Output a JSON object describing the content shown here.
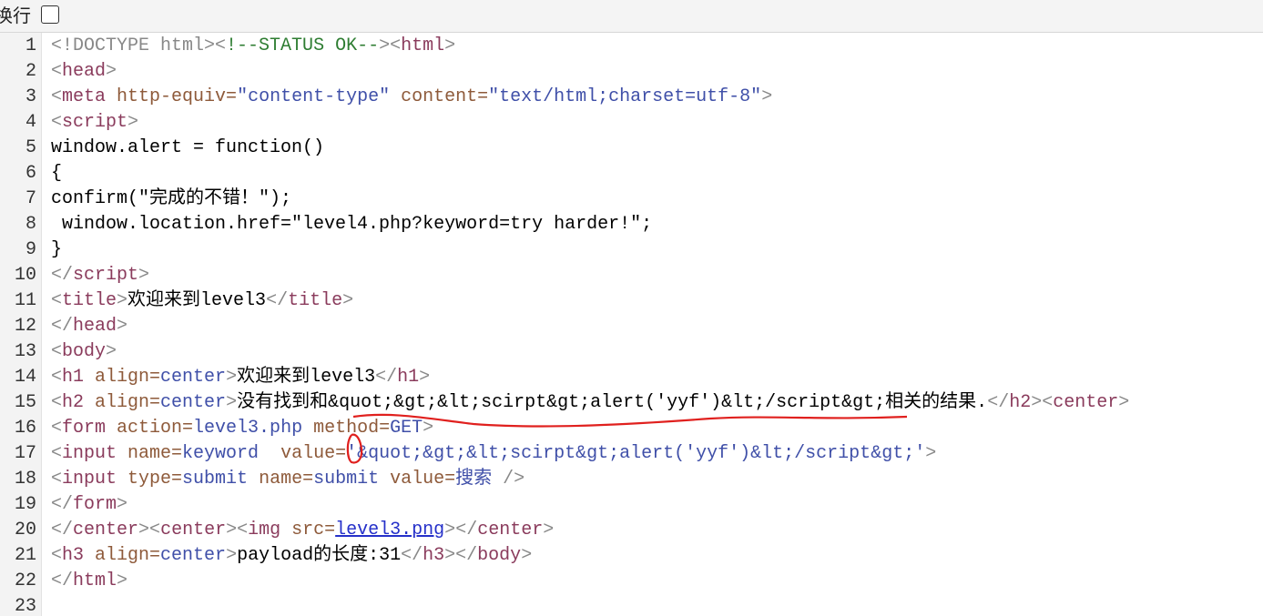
{
  "toolbar": {
    "wrap_label": "换行"
  },
  "lines": [
    {
      "num": "1",
      "parts": [
        {
          "cls": "g",
          "t": "<!DOCTYPE html>"
        },
        {
          "cls": "g",
          "t": "<"
        },
        {
          "cls": "c",
          "t": "!--STATUS OK--"
        },
        {
          "cls": "g",
          "t": ">"
        },
        {
          "cls": "g",
          "t": "<"
        },
        {
          "cls": "tg",
          "t": "html"
        },
        {
          "cls": "g",
          "t": ">"
        }
      ]
    },
    {
      "num": "2",
      "parts": [
        {
          "cls": "g",
          "t": "<"
        },
        {
          "cls": "tg",
          "t": "head"
        },
        {
          "cls": "g",
          "t": ">"
        }
      ]
    },
    {
      "num": "3",
      "parts": [
        {
          "cls": "g",
          "t": "<"
        },
        {
          "cls": "tg",
          "t": "meta "
        },
        {
          "cls": "an",
          "t": "http-equiv="
        },
        {
          "cls": "av",
          "t": "\"content-type\""
        },
        {
          "cls": "k",
          "t": " "
        },
        {
          "cls": "an",
          "t": "content="
        },
        {
          "cls": "av",
          "t": "\"text/html;charset=utf-8\""
        },
        {
          "cls": "g",
          "t": ">"
        }
      ]
    },
    {
      "num": "4",
      "parts": [
        {
          "cls": "g",
          "t": "<"
        },
        {
          "cls": "tg",
          "t": "script"
        },
        {
          "cls": "g",
          "t": ">"
        }
      ]
    },
    {
      "num": "5",
      "parts": [
        {
          "cls": "k",
          "t": "window.alert = function()"
        }
      ]
    },
    {
      "num": "6",
      "parts": [
        {
          "cls": "k",
          "t": "{"
        }
      ]
    },
    {
      "num": "7",
      "parts": [
        {
          "cls": "k",
          "t": "confirm(\"完成的不错！\");"
        }
      ]
    },
    {
      "num": "8",
      "parts": [
        {
          "cls": "k",
          "t": " window.location.href=\"level4.php?keyword=try harder!\";"
        }
      ]
    },
    {
      "num": "9",
      "parts": [
        {
          "cls": "k",
          "t": "}"
        }
      ]
    },
    {
      "num": "10",
      "parts": [
        {
          "cls": "g",
          "t": "</"
        },
        {
          "cls": "tg",
          "t": "script"
        },
        {
          "cls": "g",
          "t": ">"
        }
      ]
    },
    {
      "num": "11",
      "parts": [
        {
          "cls": "g",
          "t": "<"
        },
        {
          "cls": "tg",
          "t": "title"
        },
        {
          "cls": "g",
          "t": ">"
        },
        {
          "cls": "k",
          "t": "欢迎来到level3"
        },
        {
          "cls": "g",
          "t": "</"
        },
        {
          "cls": "tg",
          "t": "title"
        },
        {
          "cls": "g",
          "t": ">"
        }
      ]
    },
    {
      "num": "12",
      "parts": [
        {
          "cls": "g",
          "t": "</"
        },
        {
          "cls": "tg",
          "t": "head"
        },
        {
          "cls": "g",
          "t": ">"
        }
      ]
    },
    {
      "num": "13",
      "parts": [
        {
          "cls": "g",
          "t": "<"
        },
        {
          "cls": "tg",
          "t": "body"
        },
        {
          "cls": "g",
          "t": ">"
        }
      ]
    },
    {
      "num": "14",
      "parts": [
        {
          "cls": "g",
          "t": "<"
        },
        {
          "cls": "tg",
          "t": "h1 "
        },
        {
          "cls": "an",
          "t": "align="
        },
        {
          "cls": "av",
          "t": "center"
        },
        {
          "cls": "g",
          "t": ">"
        },
        {
          "cls": "k",
          "t": "欢迎来到level3"
        },
        {
          "cls": "g",
          "t": "</"
        },
        {
          "cls": "tg",
          "t": "h1"
        },
        {
          "cls": "g",
          "t": ">"
        }
      ]
    },
    {
      "num": "15",
      "parts": [
        {
          "cls": "g",
          "t": "<"
        },
        {
          "cls": "tg",
          "t": "h2 "
        },
        {
          "cls": "an",
          "t": "align="
        },
        {
          "cls": "av",
          "t": "center"
        },
        {
          "cls": "g",
          "t": ">"
        },
        {
          "cls": "k",
          "t": "没有找到和&quot;&gt;&lt;scirpt&gt;alert('yyf')&lt;/script&gt;相关的结果."
        },
        {
          "cls": "g",
          "t": "</"
        },
        {
          "cls": "tg",
          "t": "h2"
        },
        {
          "cls": "g",
          "t": ">"
        },
        {
          "cls": "g",
          "t": "<"
        },
        {
          "cls": "tg",
          "t": "center"
        },
        {
          "cls": "g",
          "t": ">"
        }
      ]
    },
    {
      "num": "16",
      "parts": [
        {
          "cls": "g",
          "t": "<"
        },
        {
          "cls": "tg",
          "t": "form "
        },
        {
          "cls": "an",
          "t": "action="
        },
        {
          "cls": "av",
          "t": "level3.php"
        },
        {
          "cls": "k",
          "t": " "
        },
        {
          "cls": "an",
          "t": "method="
        },
        {
          "cls": "av",
          "t": "GET"
        },
        {
          "cls": "g",
          "t": ">"
        }
      ]
    },
    {
      "num": "17",
      "parts": [
        {
          "cls": "g",
          "t": "<"
        },
        {
          "cls": "tg",
          "t": "input "
        },
        {
          "cls": "an",
          "t": "name="
        },
        {
          "cls": "av",
          "t": "keyword"
        },
        {
          "cls": "k",
          "t": "  "
        },
        {
          "cls": "an",
          "t": "value="
        },
        {
          "cls": "av",
          "t": "'&quot;&gt;&lt;scirpt&gt;alert('yyf')&lt;/script&gt;'"
        },
        {
          "cls": "g",
          "t": ">"
        }
      ]
    },
    {
      "num": "18",
      "parts": [
        {
          "cls": "g",
          "t": "<"
        },
        {
          "cls": "tg",
          "t": "input "
        },
        {
          "cls": "an",
          "t": "type="
        },
        {
          "cls": "av",
          "t": "submit"
        },
        {
          "cls": "k",
          "t": " "
        },
        {
          "cls": "an",
          "t": "name="
        },
        {
          "cls": "av",
          "t": "submit"
        },
        {
          "cls": "k",
          "t": " "
        },
        {
          "cls": "an",
          "t": "value="
        },
        {
          "cls": "av",
          "t": "搜索"
        },
        {
          "cls": "k",
          "t": " "
        },
        {
          "cls": "g",
          "t": "/>"
        }
      ]
    },
    {
      "num": "19",
      "parts": [
        {
          "cls": "g",
          "t": "</"
        },
        {
          "cls": "tg",
          "t": "form"
        },
        {
          "cls": "g",
          "t": ">"
        }
      ]
    },
    {
      "num": "20",
      "parts": [
        {
          "cls": "g",
          "t": "</"
        },
        {
          "cls": "tg",
          "t": "center"
        },
        {
          "cls": "g",
          "t": ">"
        },
        {
          "cls": "g",
          "t": "<"
        },
        {
          "cls": "tg",
          "t": "center"
        },
        {
          "cls": "g",
          "t": ">"
        },
        {
          "cls": "g",
          "t": "<"
        },
        {
          "cls": "tg",
          "t": "img "
        },
        {
          "cls": "an",
          "t": "src="
        },
        {
          "cls": "lnk",
          "t": "level3.png"
        },
        {
          "cls": "g",
          "t": ">"
        },
        {
          "cls": "g",
          "t": "</"
        },
        {
          "cls": "tg",
          "t": "center"
        },
        {
          "cls": "g",
          "t": ">"
        }
      ]
    },
    {
      "num": "21",
      "parts": [
        {
          "cls": "g",
          "t": "<"
        },
        {
          "cls": "tg",
          "t": "h3 "
        },
        {
          "cls": "an",
          "t": "align="
        },
        {
          "cls": "av",
          "t": "center"
        },
        {
          "cls": "g",
          "t": ">"
        },
        {
          "cls": "k",
          "t": "payload的长度:31"
        },
        {
          "cls": "g",
          "t": "</"
        },
        {
          "cls": "tg",
          "t": "h3"
        },
        {
          "cls": "g",
          "t": ">"
        },
        {
          "cls": "g",
          "t": "</"
        },
        {
          "cls": "tg",
          "t": "body"
        },
        {
          "cls": "g",
          "t": ">"
        }
      ]
    },
    {
      "num": "22",
      "parts": [
        {
          "cls": "g",
          "t": "</"
        },
        {
          "cls": "tg",
          "t": "html"
        },
        {
          "cls": "g",
          "t": ">"
        }
      ]
    },
    {
      "num": "23",
      "parts": []
    }
  ]
}
